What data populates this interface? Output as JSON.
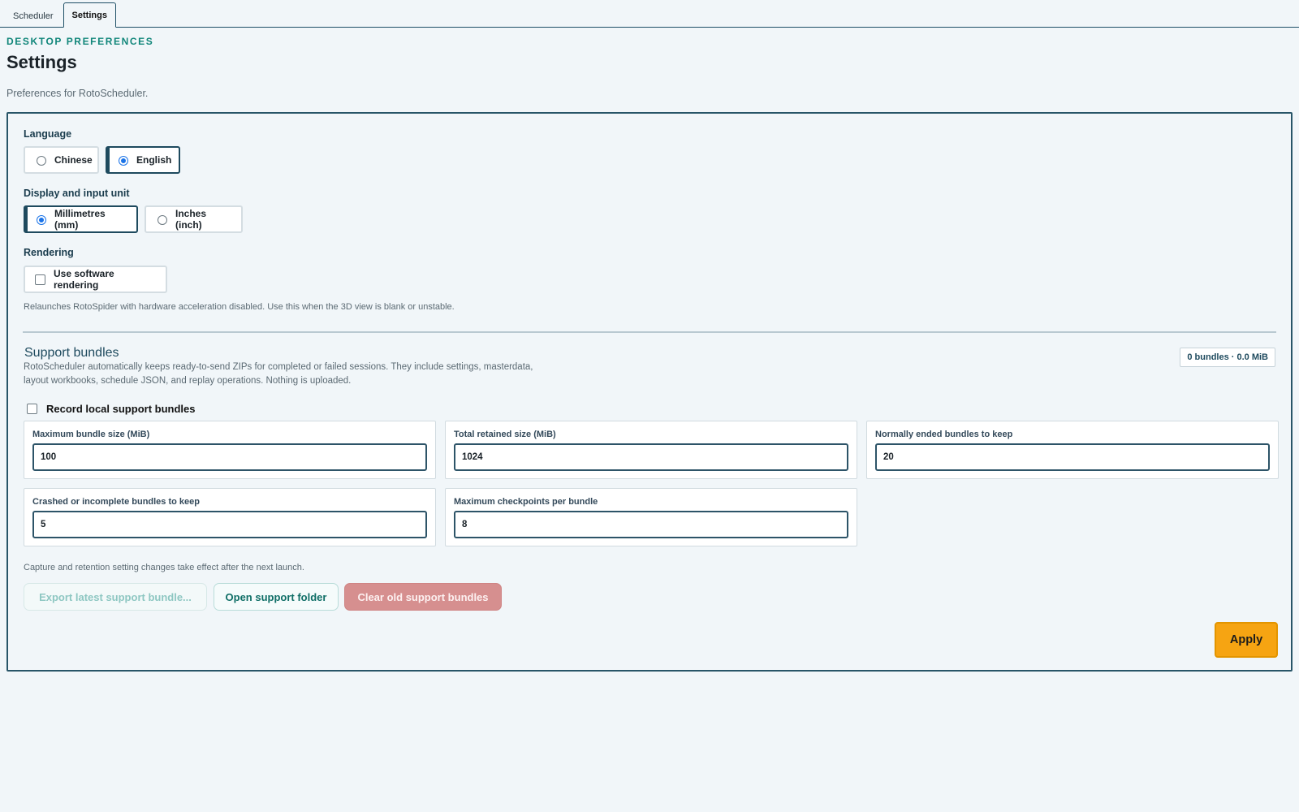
{
  "tabs": [
    {
      "label": "Scheduler",
      "active": false
    },
    {
      "label": "Settings",
      "active": true
    }
  ],
  "header": {
    "eyebrow": "DESKTOP PREFERENCES",
    "title": "Settings",
    "subtitle": "Preferences for RotoScheduler."
  },
  "language": {
    "label": "Language",
    "options": [
      {
        "label": "Chinese",
        "selected": false
      },
      {
        "label": "English",
        "selected": true
      }
    ]
  },
  "unit": {
    "label": "Display and input unit",
    "options": [
      {
        "label": "Millimetres (mm)",
        "selected": true
      },
      {
        "label": "Inches (inch)",
        "selected": false
      }
    ]
  },
  "rendering": {
    "label": "Rendering",
    "checkbox_label": "Use software rendering",
    "checked": false,
    "hint": "Relaunches RotoSpider with hardware acceleration disabled. Use this when the 3D view is blank or unstable."
  },
  "support": {
    "title": "Support bundles",
    "description": "RotoScheduler automatically keeps ready-to-send ZIPs for completed or failed sessions. They include settings, masterdata, layout workbooks, schedule JSON, and replay operations. Nothing is uploaded.",
    "stats": "0 bundles · 0.0 MiB",
    "record_label": "Record local support bundles",
    "record_checked": false,
    "fields": [
      {
        "label": "Maximum bundle size (MiB)",
        "value": "100"
      },
      {
        "label": "Total retained size (MiB)",
        "value": "1024"
      },
      {
        "label": "Normally ended bundles to keep",
        "value": "20"
      },
      {
        "label": "Crashed or incomplete bundles to keep",
        "value": "5"
      },
      {
        "label": "Maximum checkpoints per bundle",
        "value": "8"
      }
    ],
    "retention_hint": "Capture and retention setting changes take effect after the next launch.",
    "buttons": {
      "export": "Export latest support bundle...",
      "open": "Open support folder",
      "clear": "Clear old support bundles"
    }
  },
  "apply_label": "Apply",
  "colors": {
    "accent_teal": "#11867a",
    "border_dark": "#285568",
    "apply_orange": "#f6a412",
    "danger": "#d68f8f"
  }
}
